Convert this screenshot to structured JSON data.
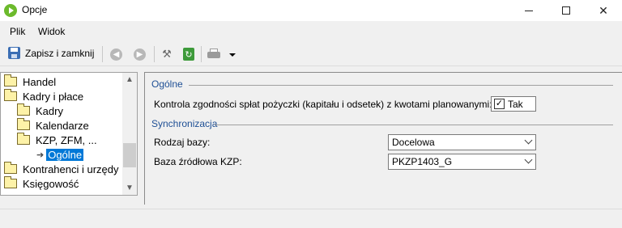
{
  "window": {
    "title": "Opcje"
  },
  "menu": {
    "items": [
      {
        "label": "Plik"
      },
      {
        "label": "Widok"
      }
    ]
  },
  "toolbar": {
    "save_label": "Zapisz i zamknij",
    "buttons": [
      "back-icon",
      "forward-icon",
      "tools-icon",
      "refresh-icon",
      "printer-icon",
      "dropdown-arrow-icon"
    ]
  },
  "tree": {
    "items": [
      {
        "label": "Handel"
      },
      {
        "label": "Kadry i płace"
      },
      {
        "label": "Kadry"
      },
      {
        "label": "Kalendarze"
      },
      {
        "label": "KZP, ZFM, ..."
      },
      {
        "label": "Ogólne",
        "selected": true
      },
      {
        "label": "Kontrahenci i urzędy"
      },
      {
        "label": "Księgowość"
      }
    ]
  },
  "form": {
    "section_general": "Ogólne",
    "kzp_label": "Kontrola zgodności spłat pożyczki (kapitału i odsetek) z kwotami planowanymi:",
    "kzp_value": "Tak",
    "kzp_checked": true,
    "section_sync": "Synchronizacja",
    "db_type_label": "Rodzaj bazy:",
    "db_type_value": "Docelowa",
    "source_db_label": "Baza źródłowa KZP:",
    "source_db_value": "PKZP1403_G"
  },
  "colors": {
    "selection": "#0078d7",
    "section_header": "#1e4f95",
    "app_icon": "#6cba2c"
  }
}
